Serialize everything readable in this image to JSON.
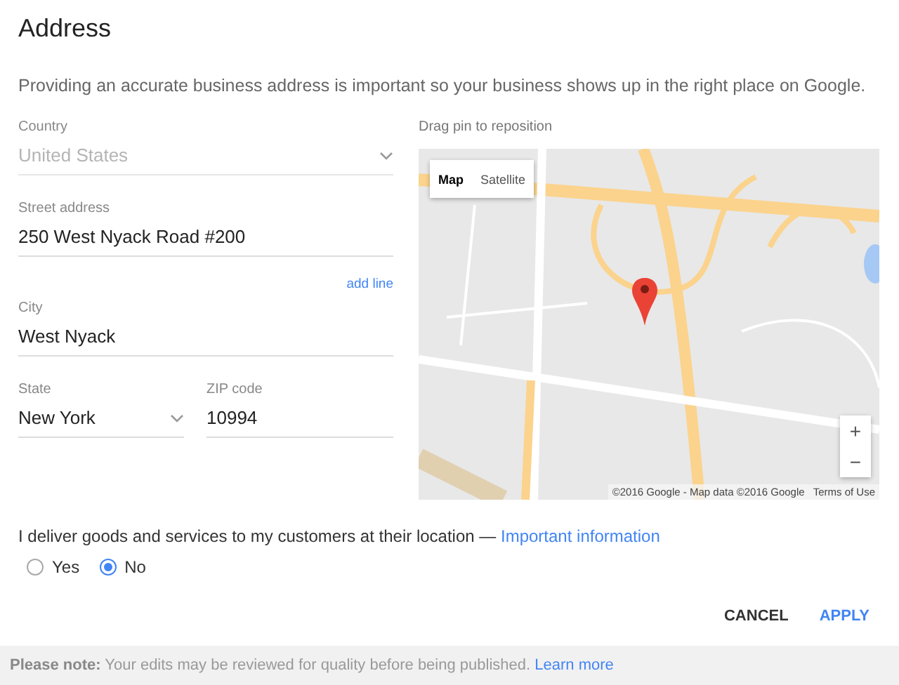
{
  "title": "Address",
  "description": "Providing an accurate business address is important so your business shows up in the right place on Google.",
  "country": {
    "kind": "select",
    "label": "Country",
    "value": "United States",
    "disabled": true
  },
  "street": {
    "kind": "text",
    "label": "Street address",
    "value": "250 West Nyack Road #200"
  },
  "add_line": "add line",
  "city": {
    "kind": "text",
    "label": "City",
    "value": "West Nyack"
  },
  "state": {
    "kind": "select",
    "label": "State",
    "value": "New York",
    "disabled": false
  },
  "zip": {
    "kind": "text",
    "label": "ZIP code",
    "value": "10994"
  },
  "map": {
    "caption": "Drag pin to reposition",
    "map_types": [
      {
        "label": "Map",
        "selected": true
      },
      {
        "label": "Satellite",
        "selected": false
      }
    ],
    "zoom_in": "+",
    "zoom_out": "−",
    "attribution": "©2016 Google - Map data ©2016 Google",
    "terms": "Terms of Use"
  },
  "question": {
    "text": "I deliver goods and services to my customers at their location —",
    "link": "Important information",
    "options": [
      {
        "label": "Yes",
        "selected": false
      },
      {
        "label": "No",
        "selected": true
      }
    ]
  },
  "buttons": [
    {
      "label": "CANCEL",
      "kind": "secondary"
    },
    {
      "label": "APPLY",
      "kind": "primary"
    }
  ],
  "footer": {
    "text": "**Please note:** Your edits may be reviewed for quality before being published.",
    "link": "Learn more"
  }
}
